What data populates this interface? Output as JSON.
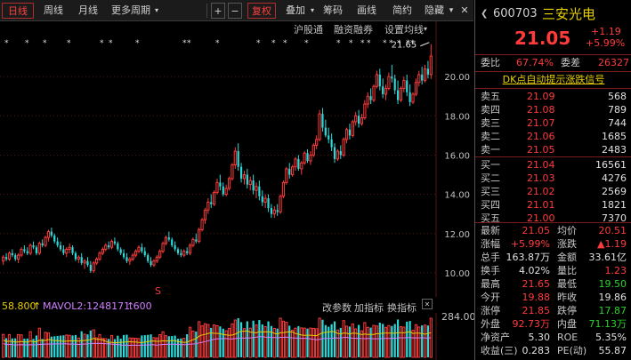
{
  "toolbar": {
    "daily": "日线",
    "weekly": "周线",
    "monthly": "月线",
    "more_periods": "更多周期",
    "plus": "+",
    "minus": "−",
    "restore_rights": "复权",
    "overlay": "叠加",
    "chips": "筹码",
    "draw_line": "画线",
    "review": "简约",
    "hide": "隐藏"
  },
  "subbar": {
    "hk_connect": "沪股通",
    "margin": "融资融券",
    "settings": "设置均线"
  },
  "chart_data": {
    "type": "candlestick",
    "ylim": [
      9.0,
      22.0
    ],
    "yticks": [
      "20.00",
      "18.00",
      "16.00",
      "14.00",
      "12.00",
      "10.00"
    ],
    "high_label": "21.65",
    "marker_s": "S",
    "candles": [
      [
        10.6,
        10.9,
        10.4,
        10.8
      ],
      [
        10.8,
        11.0,
        10.6,
        10.7
      ],
      [
        10.7,
        11.1,
        10.6,
        11.0
      ],
      [
        11.0,
        11.2,
        10.8,
        10.9
      ],
      [
        10.9,
        11.0,
        10.6,
        10.7
      ],
      [
        10.7,
        11.0,
        10.5,
        10.9
      ],
      [
        10.9,
        11.3,
        10.8,
        11.2
      ],
      [
        11.2,
        11.4,
        11.0,
        11.1
      ],
      [
        11.1,
        11.3,
        10.9,
        11.0
      ],
      [
        11.0,
        11.5,
        10.9,
        11.4
      ],
      [
        11.4,
        11.6,
        11.2,
        11.3
      ],
      [
        11.3,
        11.4,
        10.9,
        11.0
      ],
      [
        11.0,
        11.6,
        10.9,
        11.5
      ],
      [
        11.5,
        11.7,
        11.3,
        11.4
      ],
      [
        11.4,
        11.9,
        11.3,
        11.8
      ],
      [
        11.8,
        12.2,
        11.6,
        12.1
      ],
      [
        12.1,
        12.3,
        11.8,
        11.9
      ],
      [
        11.9,
        12.0,
        11.5,
        11.6
      ],
      [
        11.6,
        11.8,
        11.3,
        11.4
      ],
      [
        11.4,
        11.6,
        11.1,
        11.2
      ],
      [
        11.2,
        11.4,
        10.9,
        11.0
      ],
      [
        11.0,
        11.3,
        10.8,
        11.2
      ],
      [
        11.2,
        11.5,
        11.0,
        11.3
      ],
      [
        11.3,
        11.4,
        10.9,
        11.0
      ],
      [
        11.0,
        11.1,
        10.6,
        10.7
      ],
      [
        10.7,
        10.9,
        10.5,
        10.8
      ],
      [
        10.8,
        11.0,
        10.4,
        10.5
      ],
      [
        10.5,
        10.7,
        10.2,
        10.6
      ],
      [
        10.6,
        10.8,
        10.3,
        10.4
      ],
      [
        10.4,
        10.6,
        10.0,
        10.1
      ],
      [
        10.1,
        10.6,
        10.0,
        10.5
      ],
      [
        10.5,
        10.8,
        10.4,
        10.7
      ],
      [
        10.7,
        11.1,
        10.6,
        11.0
      ],
      [
        11.0,
        11.3,
        10.9,
        11.2
      ],
      [
        11.2,
        11.5,
        11.1,
        11.4
      ],
      [
        11.4,
        11.6,
        11.2,
        11.3
      ],
      [
        11.3,
        11.7,
        11.2,
        11.6
      ],
      [
        11.6,
        11.8,
        11.4,
        11.5
      ],
      [
        11.5,
        11.6,
        11.1,
        11.2
      ],
      [
        11.2,
        11.3,
        10.9,
        11.0
      ],
      [
        11.0,
        11.2,
        10.7,
        10.8
      ],
      [
        10.8,
        11.0,
        10.5,
        10.6
      ],
      [
        10.6,
        10.8,
        10.4,
        10.7
      ],
      [
        10.7,
        11.0,
        10.6,
        10.9
      ],
      [
        10.9,
        11.2,
        10.8,
        11.1
      ],
      [
        11.1,
        11.4,
        11.0,
        11.3
      ],
      [
        11.3,
        11.5,
        11.0,
        11.1
      ],
      [
        11.1,
        11.3,
        10.8,
        10.9
      ],
      [
        10.9,
        11.0,
        10.5,
        10.6
      ],
      [
        10.6,
        10.8,
        10.3,
        10.4
      ],
      [
        10.4,
        10.7,
        10.3,
        10.6
      ],
      [
        10.6,
        10.9,
        10.5,
        10.8
      ],
      [
        10.8,
        11.2,
        10.7,
        11.1
      ],
      [
        11.1,
        11.6,
        11.0,
        11.5
      ],
      [
        11.5,
        11.9,
        11.4,
        11.8
      ],
      [
        11.8,
        12.1,
        11.6,
        11.7
      ],
      [
        11.7,
        11.8,
        11.3,
        11.4
      ],
      [
        11.4,
        11.6,
        11.1,
        11.2
      ],
      [
        11.2,
        11.3,
        10.9,
        11.0
      ],
      [
        11.0,
        11.2,
        10.8,
        10.9
      ],
      [
        10.9,
        11.2,
        10.8,
        11.1
      ],
      [
        11.1,
        11.3,
        10.9,
        11.0
      ],
      [
        11.0,
        11.5,
        10.9,
        11.4
      ],
      [
        11.4,
        11.8,
        11.3,
        11.7
      ],
      [
        11.7,
        12.0,
        11.5,
        11.6
      ],
      [
        11.6,
        12.3,
        11.5,
        12.2
      ],
      [
        12.2,
        12.8,
        12.1,
        12.7
      ],
      [
        12.7,
        13.3,
        12.5,
        13.2
      ],
      [
        13.2,
        13.8,
        13.0,
        13.6
      ],
      [
        13.6,
        14.0,
        13.3,
        13.5
      ],
      [
        13.5,
        14.2,
        13.4,
        14.1
      ],
      [
        14.1,
        14.8,
        14.0,
        14.6
      ],
      [
        14.6,
        15.0,
        14.2,
        14.4
      ],
      [
        14.4,
        14.6,
        13.9,
        14.0
      ],
      [
        14.0,
        14.5,
        13.9,
        14.3
      ],
      [
        14.3,
        14.9,
        14.2,
        14.8
      ],
      [
        14.8,
        15.6,
        14.7,
        15.5
      ],
      [
        15.5,
        16.4,
        15.3,
        16.2
      ],
      [
        16.2,
        16.6,
        15.2,
        15.4
      ],
      [
        15.4,
        15.6,
        14.6,
        14.8
      ],
      [
        14.8,
        15.2,
        14.5,
        15.0
      ],
      [
        15.0,
        15.3,
        14.3,
        14.5
      ],
      [
        14.5,
        14.9,
        14.2,
        14.7
      ],
      [
        14.7,
        15.0,
        14.0,
        14.2
      ],
      [
        14.2,
        14.6,
        13.8,
        14.4
      ],
      [
        14.4,
        14.7,
        13.7,
        13.9
      ],
      [
        13.9,
        14.2,
        13.4,
        13.6
      ],
      [
        13.6,
        14.0,
        13.3,
        13.8
      ],
      [
        13.8,
        14.0,
        13.1,
        13.3
      ],
      [
        13.3,
        13.5,
        12.8,
        13.0
      ],
      [
        13.0,
        13.4,
        12.8,
        13.2
      ],
      [
        13.2,
        13.5,
        12.9,
        13.1
      ],
      [
        13.1,
        14.0,
        13.0,
        13.9
      ],
      [
        13.9,
        14.7,
        13.8,
        14.6
      ],
      [
        14.6,
        15.4,
        14.5,
        15.3
      ],
      [
        15.3,
        15.6,
        14.8,
        15.0
      ],
      [
        15.0,
        15.5,
        14.9,
        15.4
      ],
      [
        15.4,
        15.9,
        15.2,
        15.8
      ],
      [
        15.8,
        16.0,
        15.2,
        15.3
      ],
      [
        15.3,
        15.7,
        15.0,
        15.6
      ],
      [
        15.6,
        16.2,
        15.5,
        16.1
      ],
      [
        16.1,
        16.3,
        15.6,
        15.7
      ],
      [
        15.7,
        16.2,
        15.5,
        16.0
      ],
      [
        16.0,
        16.6,
        15.9,
        16.5
      ],
      [
        16.5,
        17.0,
        16.3,
        16.8
      ],
      [
        16.8,
        18.3,
        16.7,
        18.1
      ],
      [
        18.1,
        18.4,
        17.2,
        17.4
      ],
      [
        17.4,
        17.8,
        16.9,
        17.0
      ],
      [
        17.0,
        17.4,
        16.6,
        16.8
      ],
      [
        16.8,
        17.1,
        16.2,
        16.4
      ],
      [
        16.4,
        16.6,
        15.6,
        15.8
      ],
      [
        15.8,
        16.3,
        15.7,
        16.2
      ],
      [
        16.2,
        16.5,
        15.8,
        16.0
      ],
      [
        16.0,
        16.9,
        15.9,
        16.8
      ],
      [
        16.8,
        17.4,
        16.6,
        17.3
      ],
      [
        17.3,
        17.6,
        16.8,
        17.0
      ],
      [
        17.0,
        17.8,
        16.9,
        17.7
      ],
      [
        17.7,
        18.2,
        17.5,
        18.0
      ],
      [
        18.0,
        18.3,
        17.4,
        17.6
      ],
      [
        17.6,
        18.1,
        17.5,
        17.9
      ],
      [
        17.9,
        18.8,
        17.8,
        18.6
      ],
      [
        18.6,
        19.2,
        18.4,
        19.0
      ],
      [
        19.0,
        19.4,
        18.6,
        18.8
      ],
      [
        18.8,
        19.6,
        18.7,
        19.5
      ],
      [
        19.5,
        20.3,
        19.4,
        20.1
      ],
      [
        20.1,
        20.4,
        19.3,
        19.5
      ],
      [
        19.5,
        19.9,
        18.9,
        19.1
      ],
      [
        19.1,
        19.6,
        18.8,
        19.4
      ],
      [
        19.4,
        20.2,
        19.3,
        20.0
      ],
      [
        20.0,
        20.6,
        19.7,
        19.9
      ],
      [
        19.9,
        20.1,
        19.1,
        19.3
      ],
      [
        19.3,
        19.8,
        18.6,
        18.8
      ],
      [
        18.8,
        19.5,
        18.7,
        19.4
      ],
      [
        19.4,
        20.0,
        19.2,
        19.8
      ],
      [
        19.8,
        20.1,
        19.0,
        19.2
      ],
      [
        19.2,
        19.6,
        18.5,
        18.7
      ],
      [
        18.7,
        19.2,
        18.6,
        19.1
      ],
      [
        19.1,
        19.9,
        19.0,
        19.7
      ],
      [
        19.7,
        20.3,
        19.5,
        20.1
      ],
      [
        20.1,
        20.5,
        19.6,
        19.8
      ],
      [
        19.8,
        20.6,
        19.7,
        20.4
      ],
      [
        20.4,
        20.8,
        19.9,
        20.1
      ],
      [
        20.1,
        21.65,
        19.88,
        21.05
      ]
    ]
  },
  "volbar": {
    "ma_text": "58.800",
    "mavol2": "MAVOL2:1248171.600",
    "change_params": "改参数",
    "add_indicator": "加指标",
    "switch_indicator": "换指标",
    "vol_tick": "284.00"
  },
  "quote": {
    "code": "600703",
    "name": "三安光电",
    "price": "21.05",
    "change": "+1.19",
    "change_pct": "+5.99%",
    "weibi_label": "委比",
    "weibi": "67.74%",
    "weicha_label": "委差",
    "weicha": "26327",
    "signal": "DK点自动提示涨跌信号",
    "asks": [
      {
        "label": "卖五",
        "price": "21.09",
        "vol": "568"
      },
      {
        "label": "卖四",
        "price": "21.08",
        "vol": "789"
      },
      {
        "label": "卖三",
        "price": "21.07",
        "vol": "744"
      },
      {
        "label": "卖二",
        "price": "21.06",
        "vol": "1685"
      },
      {
        "label": "卖一",
        "price": "21.05",
        "vol": "2483"
      }
    ],
    "bids": [
      {
        "label": "买一",
        "price": "21.04",
        "vol": "16561"
      },
      {
        "label": "买二",
        "price": "21.03",
        "vol": "4276"
      },
      {
        "label": "买三",
        "price": "21.02",
        "vol": "2569"
      },
      {
        "label": "买四",
        "price": "21.01",
        "vol": "1821"
      },
      {
        "label": "买五",
        "price": "21.00",
        "vol": "7370"
      }
    ],
    "stats": [
      {
        "l1": "最新",
        "v1": "21.05",
        "c1": "red",
        "l2": "均价",
        "v2": "20.51",
        "c2": "red"
      },
      {
        "l1": "涨幅",
        "v1": "+5.99%",
        "c1": "red",
        "l2": "涨跌",
        "v2": "▲1.19",
        "c2": "red"
      },
      {
        "l1": "总手",
        "v1": "163.87万",
        "c1": "wht",
        "l2": "金额",
        "v2": "33.61亿",
        "c2": "wht"
      },
      {
        "l1": "换手",
        "v1": "4.02%",
        "c1": "wht",
        "l2": "量比",
        "v2": "1.23",
        "c2": "red"
      },
      {
        "l1": "最高",
        "v1": "21.65",
        "c1": "red",
        "l2": "最低",
        "v2": "19.50",
        "c2": "grn"
      },
      {
        "l1": "今开",
        "v1": "19.88",
        "c1": "red",
        "l2": "昨收",
        "v2": "19.86",
        "c2": "wht"
      },
      {
        "l1": "涨停",
        "v1": "21.85",
        "c1": "red",
        "l2": "跌停",
        "v2": "17.87",
        "c2": "grn"
      },
      {
        "l1": "外盘",
        "v1": "92.73万",
        "c1": "red",
        "l2": "内盘",
        "v2": "71.13万",
        "c2": "grn"
      },
      {
        "l1": "净资产",
        "v1": "5.30",
        "c1": "wht",
        "l2": "ROE",
        "v2": "5.35%",
        "c2": "wht"
      },
      {
        "l1": "收益(三)",
        "v1": "0.283",
        "c1": "wht",
        "l2": "PE(动)",
        "v2": "55.87",
        "c2": "wht"
      }
    ]
  },
  "colors": {
    "up": "#ff3b3b",
    "down": "#2bd9d9",
    "accent": "#e8d000"
  }
}
